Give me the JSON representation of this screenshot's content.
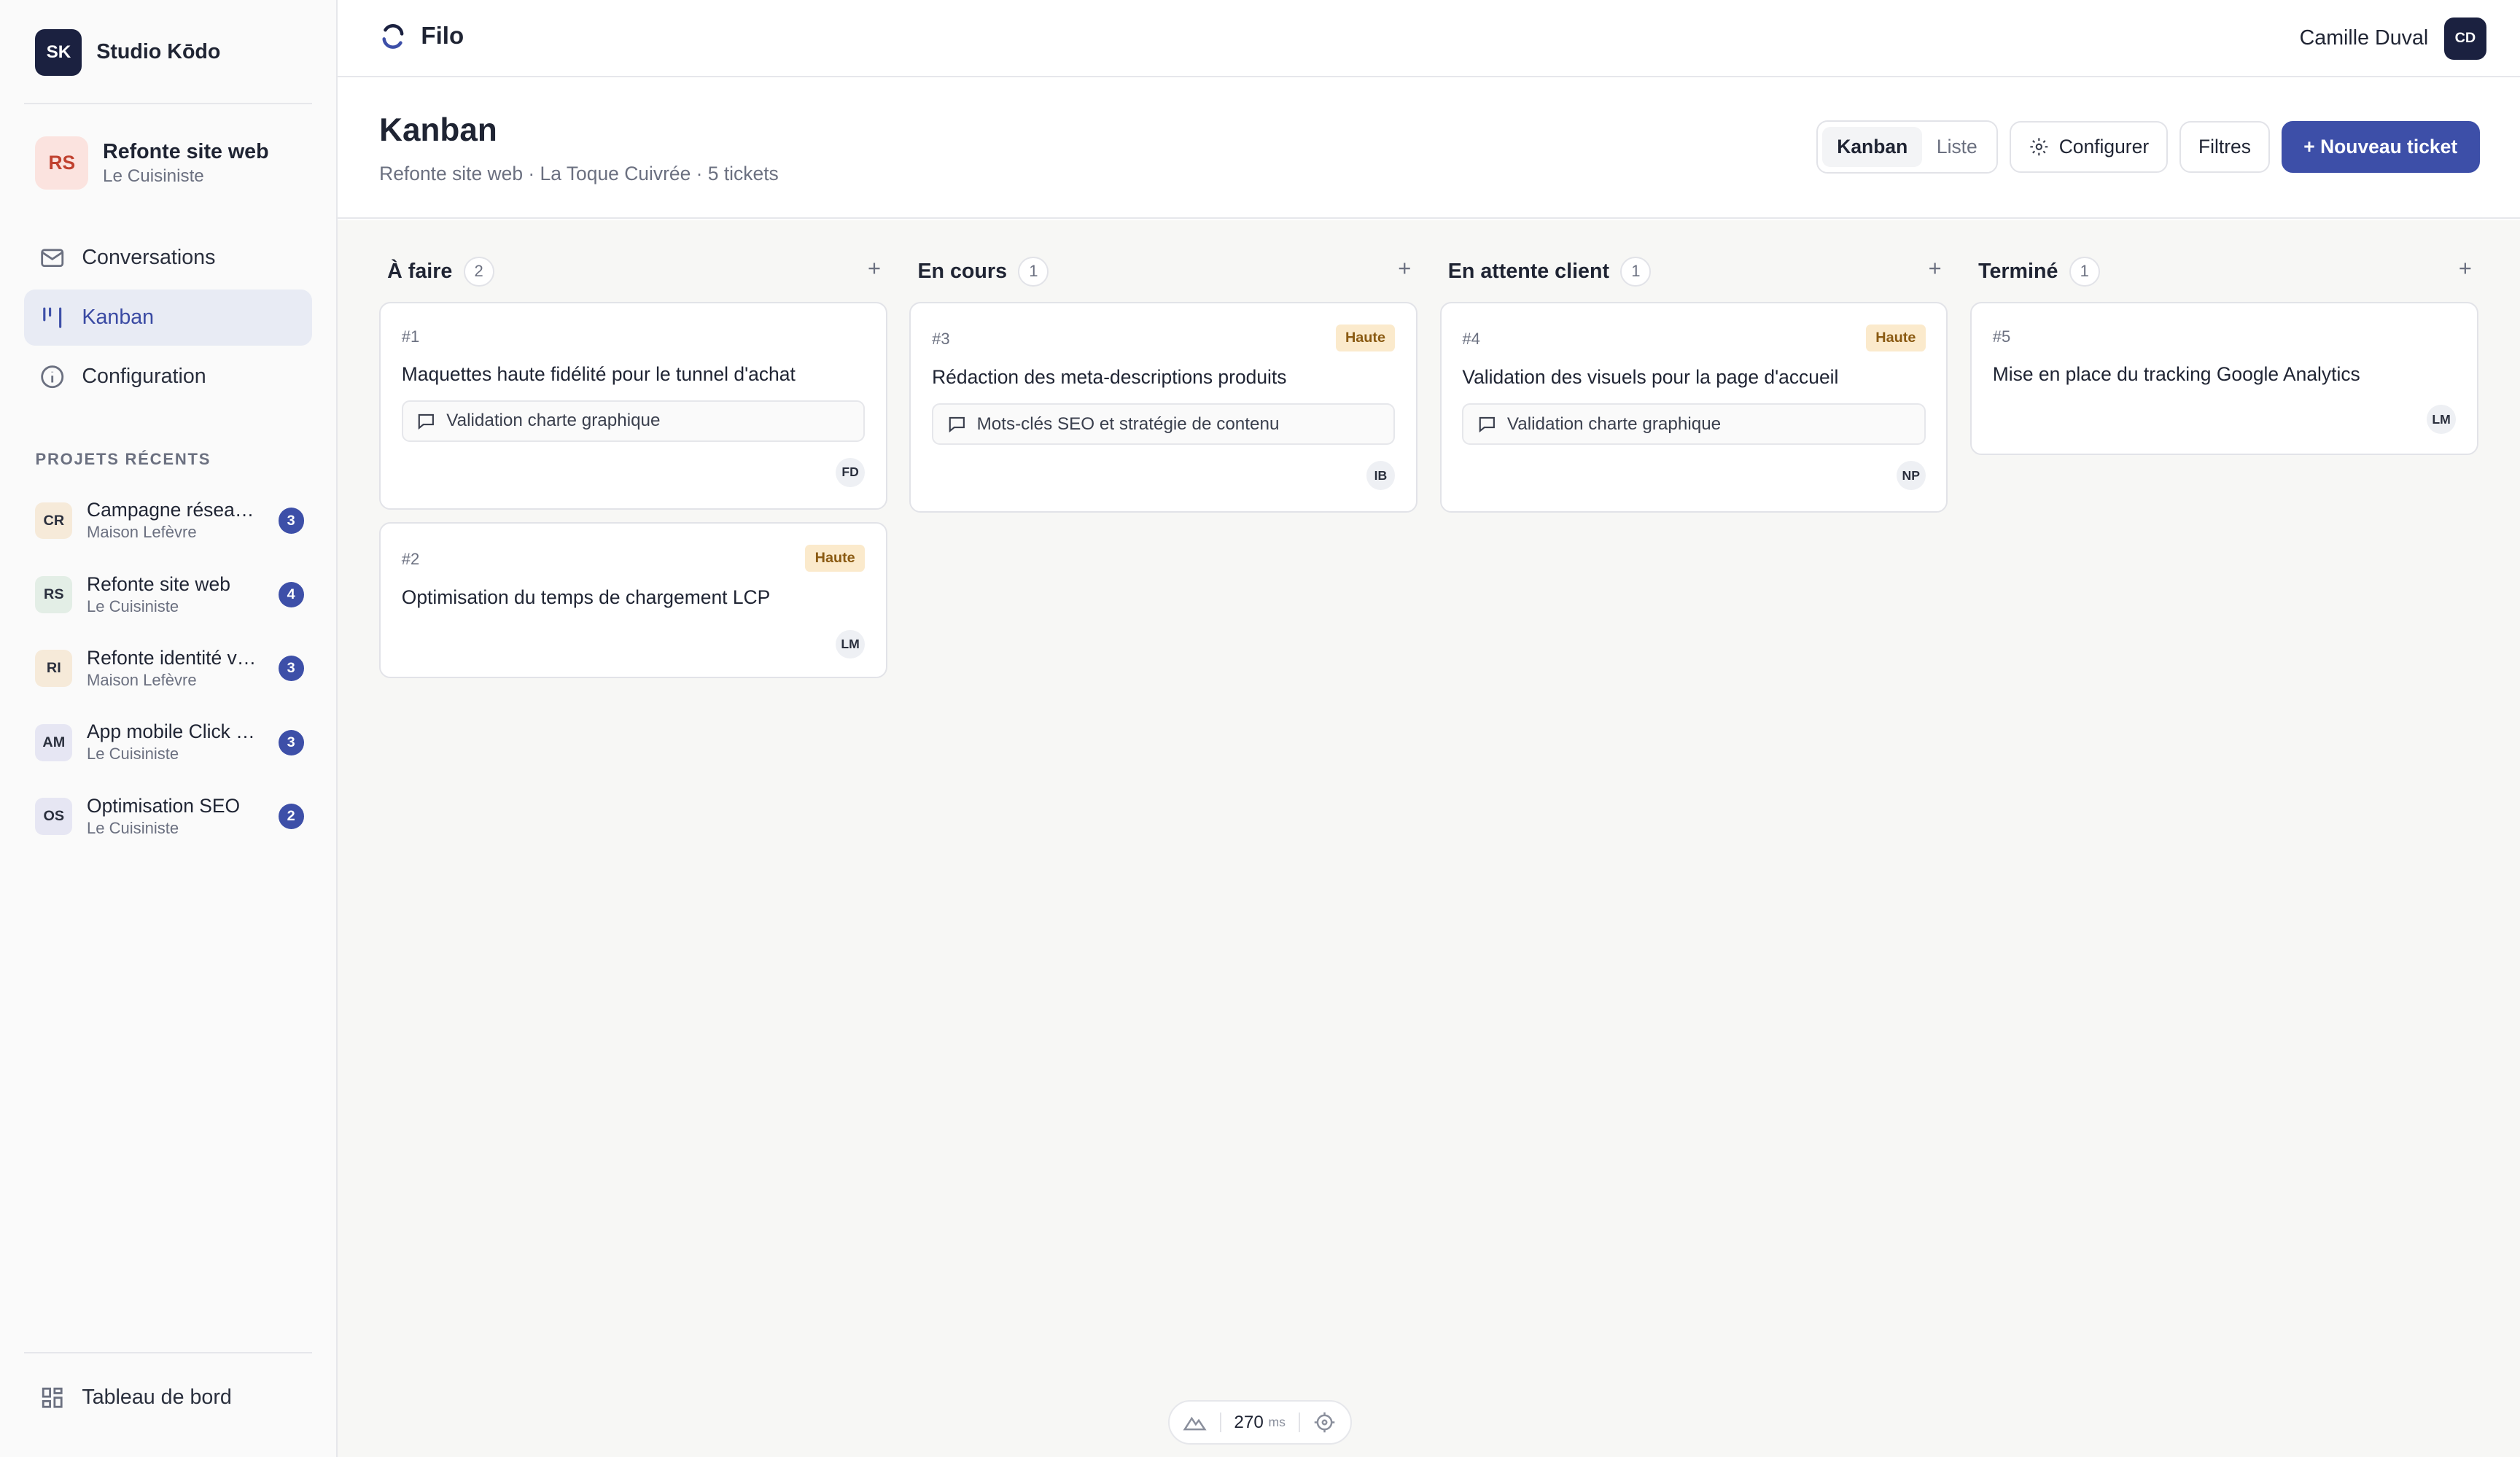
{
  "workspace": {
    "initials": "SK",
    "name": "Studio Kōdo"
  },
  "project": {
    "initials": "RS",
    "title": "Refonte site web",
    "client": "Le Cuisiniste"
  },
  "nav": [
    {
      "label": "Conversations",
      "icon": "mail-icon"
    },
    {
      "label": "Kanban",
      "icon": "kanban-icon",
      "active": true
    },
    {
      "label": "Configuration",
      "icon": "info-icon"
    }
  ],
  "recent_heading": "PROJETS RÉCENTS",
  "recent_projects": [
    {
      "initials": "CR",
      "title": "Campagne réseaux sociaux",
      "client": "Maison Lefèvre",
      "count": "3",
      "color": "#f6ead9"
    },
    {
      "initials": "RS",
      "title": "Refonte site web",
      "client": "Le Cuisiniste",
      "count": "4",
      "color": "#e3eee6"
    },
    {
      "initials": "RI",
      "title": "Refonte identité visuelle",
      "client": "Maison Lefèvre",
      "count": "3",
      "color": "#f6ead9"
    },
    {
      "initials": "AM",
      "title": "App mobile Click & Collect",
      "client": "Le Cuisiniste",
      "count": "3",
      "color": "#e6e6f3"
    },
    {
      "initials": "OS",
      "title": "Optimisation SEO",
      "client": "Le Cuisiniste",
      "count": "2",
      "color": "#e6e6f3"
    }
  ],
  "dashboard_label": "Tableau de bord",
  "app": {
    "name": "Filo"
  },
  "user": {
    "name": "Camille Duval",
    "initials": "CD"
  },
  "page": {
    "title": "Kanban",
    "subtitle": "Refonte site web · La Toque Cuivrée · 5 tickets"
  },
  "actions": {
    "view_kanban": "Kanban",
    "view_list": "Liste",
    "configure": "Configurer",
    "filters": "Filtres",
    "new_ticket": "+ Nouveau ticket"
  },
  "columns": [
    {
      "title": "À faire",
      "count": "2",
      "cards": [
        {
          "id": "#1",
          "title": "Maquettes haute fidélité pour le tunnel d'achat",
          "conversation": "Validation charte graphique",
          "assignee": "FD"
        },
        {
          "id": "#2",
          "title": "Optimisation du temps de chargement LCP",
          "priority": "Haute",
          "assignee": "LM"
        }
      ]
    },
    {
      "title": "En cours",
      "count": "1",
      "cards": [
        {
          "id": "#3",
          "title": "Rédaction des meta-descriptions produits",
          "priority": "Haute",
          "conversation": "Mots-clés SEO et stratégie de contenu",
          "assignee": "IB"
        }
      ]
    },
    {
      "title": "En attente client",
      "count": "1",
      "cards": [
        {
          "id": "#4",
          "title": "Validation des visuels pour la page d'accueil",
          "priority": "Haute",
          "conversation": "Validation charte graphique",
          "assignee": "NP"
        }
      ]
    },
    {
      "title": "Terminé",
      "count": "1",
      "cards": [
        {
          "id": "#5",
          "title": "Mise en place du tracking Google Analytics",
          "assignee": "LM"
        }
      ]
    }
  ],
  "perf": {
    "value": "270",
    "unit": "ms"
  },
  "colors": {
    "accent": "#3d4fa8",
    "navy": "#1b2140",
    "priority_bg": "#fbeacc"
  }
}
